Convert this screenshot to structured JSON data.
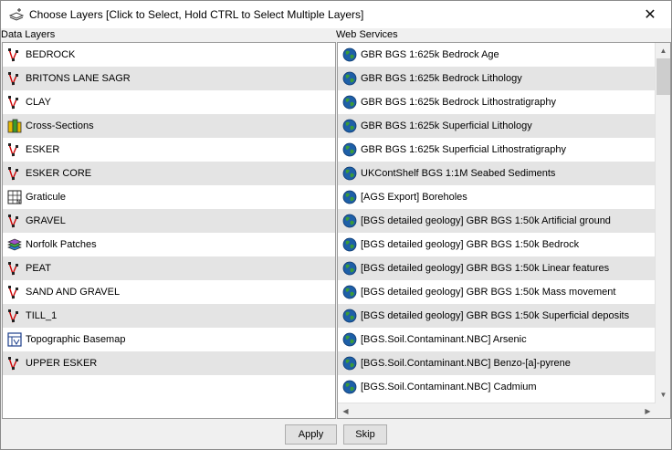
{
  "window": {
    "title": "Choose Layers  [Click to Select, Hold CTRL to Select Multiple Layers]",
    "close_label": "✕"
  },
  "data_layers": {
    "header": "Data Layers",
    "items": [
      {
        "label": "BEDROCK",
        "icon": "vector-layer-icon"
      },
      {
        "label": "BRITONS LANE SAGR",
        "icon": "vector-layer-icon"
      },
      {
        "label": "CLAY",
        "icon": "vector-layer-icon"
      },
      {
        "label": "Cross-Sections",
        "icon": "cross-section-icon"
      },
      {
        "label": "ESKER",
        "icon": "vector-layer-icon"
      },
      {
        "label": "ESKER CORE",
        "icon": "vector-layer-icon"
      },
      {
        "label": "Graticule",
        "icon": "graticule-icon"
      },
      {
        "label": "GRAVEL",
        "icon": "vector-layer-icon"
      },
      {
        "label": "Norfolk Patches",
        "icon": "stacked-layers-icon"
      },
      {
        "label": "PEAT",
        "icon": "vector-layer-icon"
      },
      {
        "label": "SAND AND GRAVEL",
        "icon": "vector-layer-icon"
      },
      {
        "label": "TILL_1",
        "icon": "vector-layer-icon"
      },
      {
        "label": "Topographic Basemap",
        "icon": "basemap-icon"
      },
      {
        "label": "UPPER ESKER",
        "icon": "vector-layer-icon"
      }
    ]
  },
  "web_services": {
    "header": "Web Services",
    "items": [
      {
        "label": "GBR BGS 1:625k Bedrock Age",
        "icon": "globe-icon"
      },
      {
        "label": "GBR BGS 1:625k Bedrock Lithology",
        "icon": "globe-icon"
      },
      {
        "label": "GBR BGS 1:625k Bedrock Lithostratigraphy",
        "icon": "globe-icon"
      },
      {
        "label": "GBR BGS 1:625k Superficial Lithology",
        "icon": "globe-icon"
      },
      {
        "label": "GBR BGS 1:625k Superficial Lithostratigraphy",
        "icon": "globe-icon"
      },
      {
        "label": "UKContShelf BGS 1:1M Seabed Sediments",
        "icon": "globe-icon"
      },
      {
        "label": "[AGS Export] Boreholes",
        "icon": "globe-icon"
      },
      {
        "label": "[BGS detailed geology] GBR BGS 1:50k Artificial ground",
        "icon": "globe-icon"
      },
      {
        "label": "[BGS detailed geology] GBR BGS 1:50k Bedrock",
        "icon": "globe-icon"
      },
      {
        "label": "[BGS detailed geology] GBR BGS 1:50k Linear features",
        "icon": "globe-icon"
      },
      {
        "label": "[BGS detailed geology] GBR BGS 1:50k Mass movement",
        "icon": "globe-icon"
      },
      {
        "label": "[BGS detailed geology] GBR BGS 1:50k Superficial deposits",
        "icon": "globe-icon"
      },
      {
        "label": "[BGS.Soil.Contaminant.NBC] Arsenic",
        "icon": "globe-icon"
      },
      {
        "label": "[BGS.Soil.Contaminant.NBC] Benzo-[a]-pyrene",
        "icon": "globe-icon"
      },
      {
        "label": "[BGS.Soil.Contaminant.NBC] Cadmium",
        "icon": "globe-icon"
      }
    ]
  },
  "buttons": {
    "apply": "Apply",
    "skip": "Skip"
  },
  "colors": {
    "row_alt": "#e4e4e4",
    "vector_icon": "#cc0000",
    "globe_ocean": "#1e5fa8",
    "globe_land": "#3a9a3a"
  }
}
